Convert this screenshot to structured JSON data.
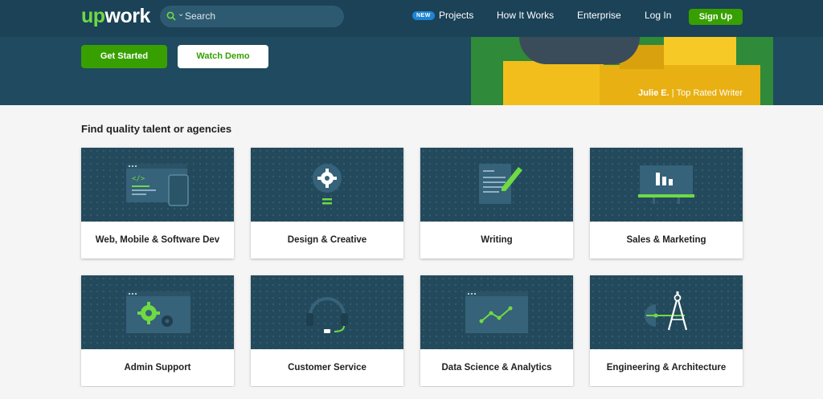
{
  "brand": {
    "logo_prefix": "up",
    "logo_suffix": "work"
  },
  "search": {
    "placeholder": "Search"
  },
  "nav": {
    "new_badge": "NEW",
    "projects": "Projects",
    "how_it_works": "How It Works",
    "enterprise": "Enterprise",
    "login": "Log In",
    "signup": "Sign Up"
  },
  "hero": {
    "get_started": "Get Started",
    "watch_demo": "Watch Demo",
    "caption_name": "Julie E.",
    "caption_sep": "|",
    "caption_title": "Top Rated Writer"
  },
  "section": {
    "title": "Find quality talent or agencies"
  },
  "categories": [
    {
      "label": "Web, Mobile & Software Dev",
      "icon": "code-window-icon"
    },
    {
      "label": "Design & Creative",
      "icon": "lightbulb-gear-icon"
    },
    {
      "label": "Writing",
      "icon": "document-pen-icon"
    },
    {
      "label": "Sales & Marketing",
      "icon": "presentation-board-icon"
    },
    {
      "label": "Admin Support",
      "icon": "gears-window-icon"
    },
    {
      "label": "Customer Service",
      "icon": "headset-icon"
    },
    {
      "label": "Data Science & Analytics",
      "icon": "line-graph-icon"
    },
    {
      "label": "Engineering & Architecture",
      "icon": "compass-icon"
    }
  ],
  "colors": {
    "accent": "#37a000",
    "navbar": "#1b4257",
    "card_art": "#234a5c",
    "icon_green": "#6fda44"
  }
}
